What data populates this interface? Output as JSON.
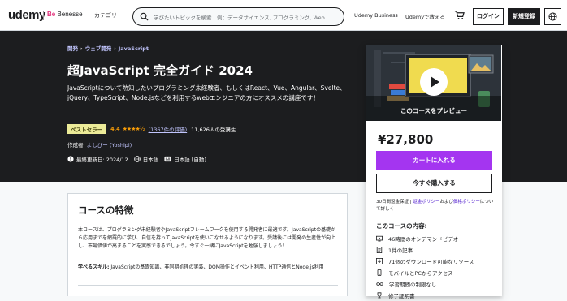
{
  "header": {
    "logo": "udemy",
    "partner": "Benesse",
    "partner_mark": "Be",
    "categories_label": "カテゴリー",
    "search_placeholder": "学びたいトピックを検索　例：データサイエンス, プログラミング, Web",
    "business_link": "Udemy Business",
    "teach_link": "Udemyで教える",
    "login_label": "ログイン",
    "signup_label": "新規登録"
  },
  "hero": {
    "breadcrumbs": [
      "開発",
      "ウェブ開発",
      "JavaScript"
    ],
    "title": "超JavaScript 完全ガイド 2024",
    "subtitle": "JavaScriptについて熟知したいプログラミング未経験者、もしくはReact、Vue、Angular、Svelte、jQuery、TypeScript、Node.jsなどを利用するwebエンジニアの方にオススメの講座です！",
    "badge": "ベストセラー",
    "rating": "4.4",
    "stars": "★★★★½",
    "rating_fraction": 0.88,
    "review_count": "(1367件の評価)",
    "students": "11,626人の受講生",
    "author_prefix": "作成者:",
    "author": "よしぴー (Yoshipi)",
    "updated": "最終更新日: 2024/12",
    "language": "日本語",
    "captions": "日本語 [自動]"
  },
  "card": {
    "preview_label": "このコースをプレビュー",
    "price": "¥27,800",
    "add_to_cart": "カートに入れる",
    "buy_now": "今すぐ購入する",
    "refund_prefix": "30日間返金保証 | ",
    "refund_link1": "返金ポリシー",
    "refund_mid": "および",
    "refund_link2": "価格ポリシー",
    "refund_suffix": "について詳しく",
    "includes_title": "このコースの内容:",
    "includes": [
      {
        "icon": "video-icon",
        "text": "46時間のオンデマンドビデオ"
      },
      {
        "icon": "article-icon",
        "text": "1件の記事"
      },
      {
        "icon": "download-icon",
        "text": "71個のダウンロード可能なリソース"
      },
      {
        "icon": "mobile-icon",
        "text": "モバイルとPCからアクセス"
      },
      {
        "icon": "infinity-icon",
        "text": "学習期間の制限なし"
      },
      {
        "icon": "trophy-icon",
        "text": "修了証明書"
      }
    ]
  },
  "features": {
    "title": "コースの特徴",
    "description": "本コースは、プログラミング未経験者やJavaScriptフレームワークを使用する開発者に最適です。JavaScriptの基礎から応用までを網羅的に学び、自信を持ってJavaScriptを使いこなせるようになります。受講後には開発の生産性が向上し、市場価値が高まることを実感できるでしょう。今すぐ一緒にJavaScriptを勉強しましょう！",
    "skills_label": "学べるスキル:",
    "skills": " JavaScriptの基礎知識、非同期処理の実装、DOM操作とイベント利用、HTTP通信とNode.js利用"
  }
}
